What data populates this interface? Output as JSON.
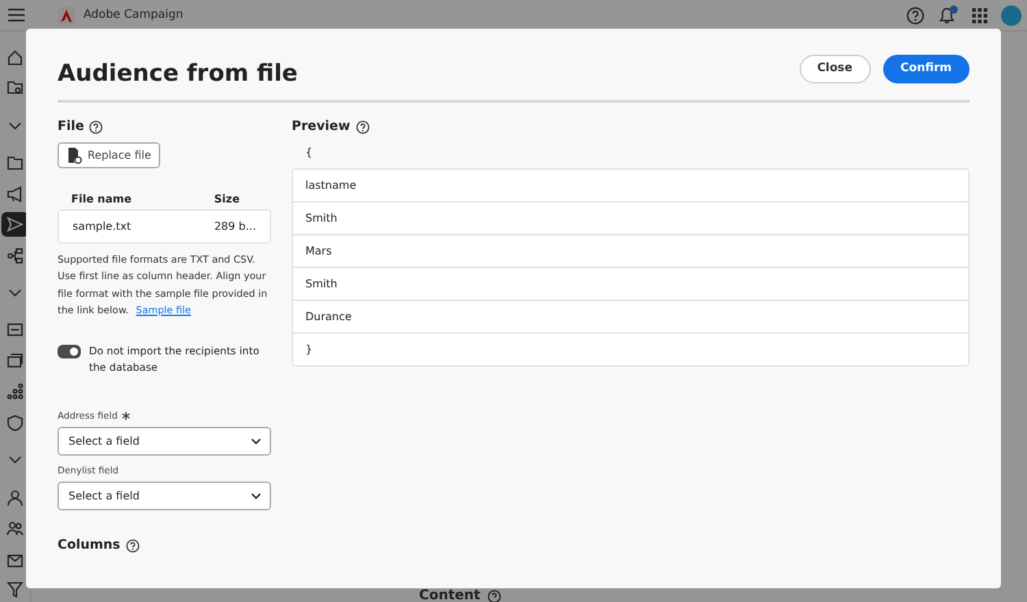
{
  "app": {
    "title": "Adobe Campaign",
    "notification_badge": true
  },
  "rail": [
    {
      "kind": "home",
      "selected": false
    },
    {
      "kind": "folder-search",
      "selected": false
    },
    {
      "kind": "chevron",
      "selected": false
    },
    {
      "kind": "folder",
      "selected": false
    },
    {
      "kind": "megaphone",
      "selected": false
    },
    {
      "kind": "send",
      "selected": true
    },
    {
      "kind": "flow",
      "selected": false
    },
    {
      "kind": "chevron",
      "selected": false
    },
    {
      "kind": "card",
      "selected": false
    },
    {
      "kind": "stack",
      "selected": false
    },
    {
      "kind": "dots",
      "selected": false
    },
    {
      "kind": "shield",
      "selected": false
    },
    {
      "kind": "chevron",
      "selected": false
    },
    {
      "kind": "person",
      "selected": false
    },
    {
      "kind": "people",
      "selected": false
    },
    {
      "kind": "mail",
      "selected": false
    },
    {
      "kind": "filter",
      "selected": false
    }
  ],
  "background": {
    "section_title": "Content"
  },
  "dialog": {
    "title": "Audience from file",
    "buttons": [
      {
        "label": "Close",
        "kind": "secondary"
      },
      {
        "label": "Confirm",
        "kind": "primary"
      }
    ],
    "file": {
      "heading": "File",
      "replace_button": "Replace file",
      "columns": [
        "File name",
        "Size"
      ],
      "row": [
        "sample.txt",
        "289 b..."
      ],
      "note": "Supported file formats are TXT and CSV. Use first line as column header. Align your file format with the sample file provided in the link below.",
      "link": "Sample file",
      "toggle": {
        "label": "Do not import the recipients into the database",
        "on": true
      },
      "fields": [
        {
          "label": "Address field",
          "required": true,
          "placeholder": "Select a field"
        },
        {
          "label": "Denylist field",
          "required": false,
          "placeholder": "Select a field"
        }
      ],
      "columns_heading": "Columns"
    },
    "preview": {
      "heading": "Preview",
      "open": "{",
      "rows": [
        "lastname",
        "Smith",
        "Mars",
        "Smith",
        "Durance",
        "}"
      ]
    }
  }
}
